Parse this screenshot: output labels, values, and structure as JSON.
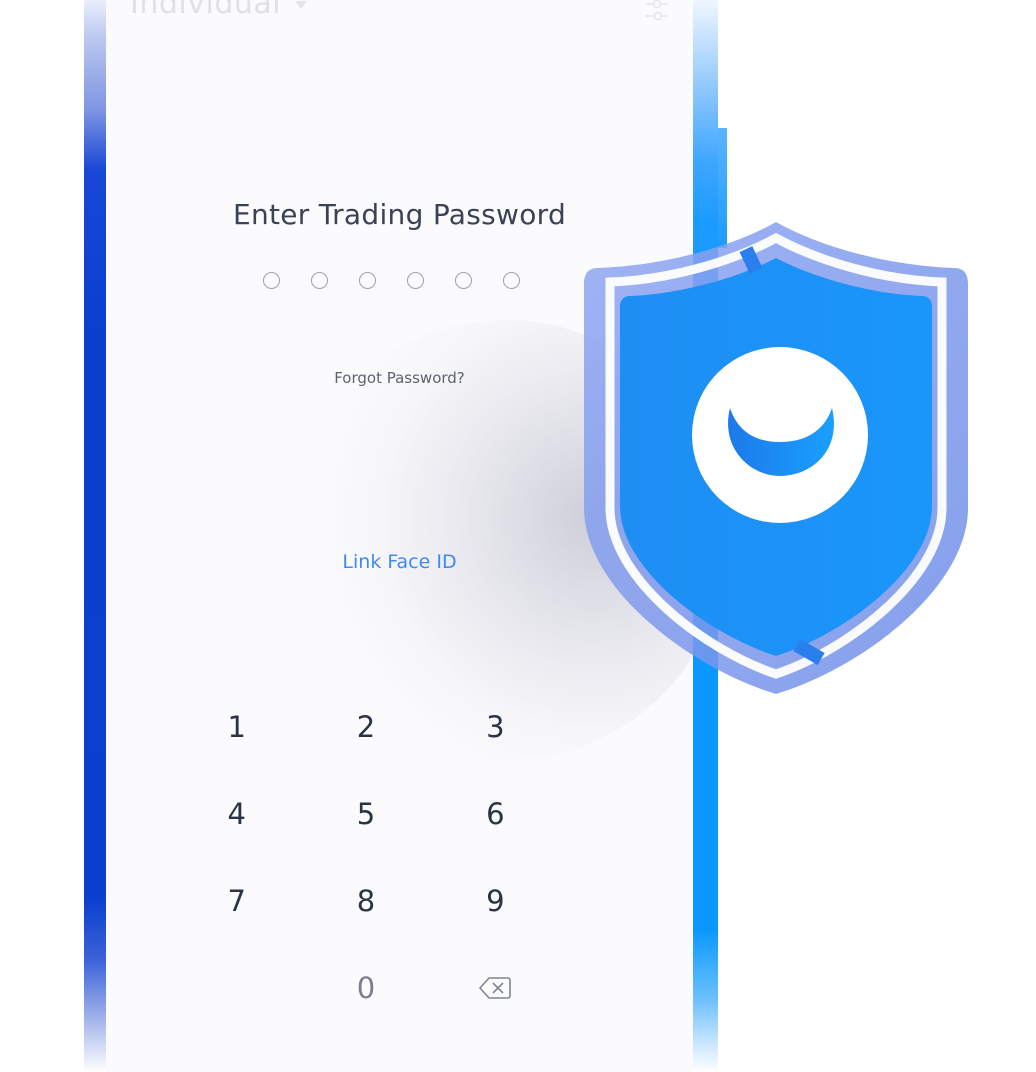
{
  "header": {
    "account_selector": "Individual",
    "account_selector_icon": "caret-down-icon",
    "settings_icon": "sliders-icon"
  },
  "password_screen": {
    "title": "Enter Trading Password",
    "pin_length": 6,
    "pin_entered": 0,
    "forgot_link": "Forgot Password?",
    "face_id_link": "Link Face ID"
  },
  "keypad": {
    "keys": [
      "1",
      "2",
      "3",
      "4",
      "5",
      "6",
      "7",
      "8",
      "9",
      "",
      "0",
      "backspace"
    ],
    "backspace_icon": "backspace-icon"
  },
  "overlay": {
    "badge_icon": "shield-logo-icon"
  },
  "colors": {
    "accent_blue": "#3d8cec",
    "shield_blue": "#1b8ff5",
    "text_dark": "#3a4256",
    "text_muted": "#5d6270"
  }
}
